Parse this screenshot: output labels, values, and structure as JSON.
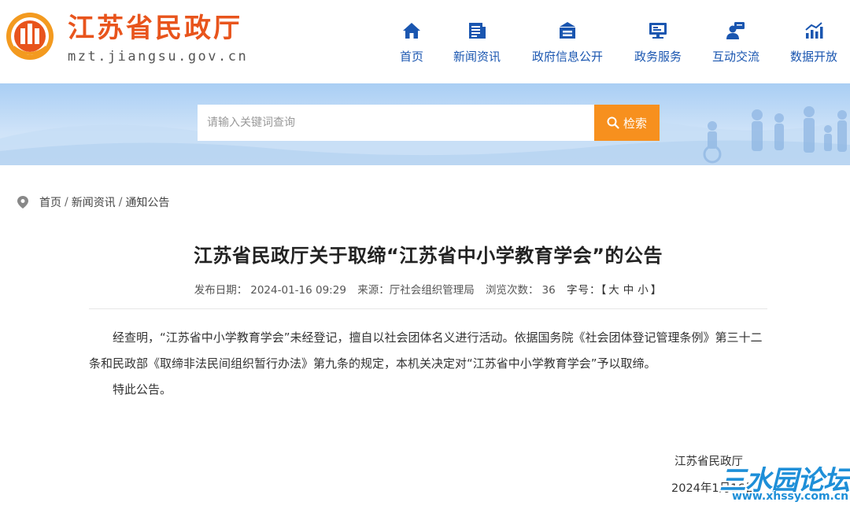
{
  "header": {
    "site_title": "江苏省民政厅",
    "site_domain": "mzt.jiangsu.gov.cn",
    "brand_color": "#e8541c",
    "nav_color": "#1a56b0"
  },
  "nav": [
    {
      "label": "首页",
      "icon": "home-icon"
    },
    {
      "label": "新闻资讯",
      "icon": "news-icon"
    },
    {
      "label": "政府信息公开",
      "icon": "archive-icon"
    },
    {
      "label": "政务服务",
      "icon": "monitor-icon"
    },
    {
      "label": "互动交流",
      "icon": "chat-user-icon"
    },
    {
      "label": "数据开放",
      "icon": "chart-icon"
    }
  ],
  "search": {
    "placeholder": "请输入关键词查询",
    "button_label": "检索",
    "button_color": "#f7901e"
  },
  "breadcrumb": {
    "items": [
      "首页",
      "新闻资讯",
      "通知公告"
    ],
    "separator": "/"
  },
  "article": {
    "title": "江苏省民政厅关于取缔“江苏省中小学教育学会”的公告",
    "meta": {
      "date_label": "发布日期：",
      "date": "2024-01-16 09:29",
      "source_label": "来源：",
      "source": "厅社会组织管理局",
      "views_label": "浏览次数：",
      "views": "36",
      "font_label": "字号：",
      "font_open": "【",
      "font_large": "大",
      "font_medium": "中",
      "font_small": "小",
      "font_close": "】"
    },
    "paragraphs": [
      "经查明，“江苏省中小学教育学会”未经登记，擅自以社会团体名义进行活动。依据国务院《社会团体登记管理条例》第三十二条和民政部《取缔非法民间组织暂行办法》第九条的规定，本机关决定对“江苏省中小学教育学会”予以取缔。",
      "特此公告。"
    ],
    "signature": "江苏省民政厅",
    "sign_date": "2024年1月16日"
  },
  "watermark": {
    "title": "三水园论坛",
    "url": "www.xhssy.com.cn"
  }
}
